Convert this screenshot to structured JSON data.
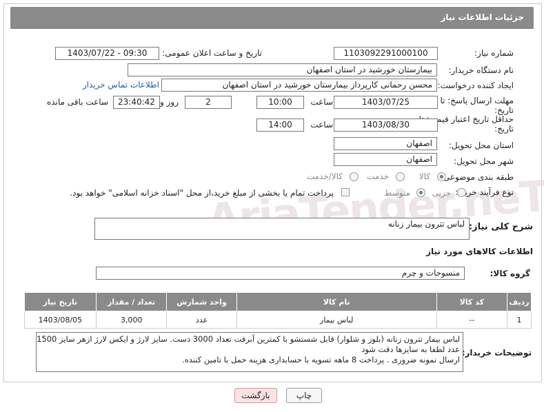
{
  "header": {
    "title": "جزئیات اطلاعات نیاز"
  },
  "fields": {
    "need_number_label": "شماره نیاز:",
    "need_number": "1103092291000100",
    "announce_label": "تاریخ و ساعت اعلان عمومی:",
    "announce_value": "1403/07/22 - 09:30",
    "buyer_org_label": "نام دستگاه خریدار:",
    "buyer_org": "بیمارستان خورشید در استان اصفهان",
    "requester_label": "ایجاد کننده درخواست:",
    "requester": "محسن رحمانی کارپرداز بیمارستان خورشید در استان اصفهان",
    "buyer_contact_link": "اطلاعات تماس خریدار",
    "reply_deadline_label": "مهلت ارسال پاسخ: تا",
    "reply_deadline_label2": "تاریخ:",
    "reply_date": "1403/07/25",
    "time_label": "ساعت",
    "reply_time": "10:00",
    "days_value": "2",
    "days_label": "روز و",
    "remaining_time": "23:40:42",
    "remaining_label": "ساعت باقی مانده",
    "price_validity_label": "حداقل تاریخ اعتبار قیمت: تا",
    "price_validity_label2": "تاریخ:",
    "price_validity_date": "1403/08/30",
    "price_validity_time": "14:00",
    "province_label": "استان محل تحویل:",
    "province": "اصفهان",
    "city_label": "شهر محل تحویل:",
    "city": "اصفهان",
    "category_label": "طبقه بندی موضوعی:",
    "category_options": [
      "کالا",
      "خدمت",
      "کالا/خدمت"
    ],
    "category_selected": "کالا",
    "process_label": "نوع فرآیند خرید :",
    "process_options": [
      "جزیی",
      "متوسط"
    ],
    "process_selected": "متوسط",
    "payment_note": "پرداخت تمام یا بخشی از مبلغ خرید،از محل \"اسناد خزانه اسلامی\" خواهد بود."
  },
  "summary": {
    "label": "شرح کلی نیاز:",
    "text": "لباس تترون بیمار زنانه"
  },
  "goods": {
    "section_title": "اطلاعات کالاهای مورد نیاز",
    "group_label": "گروه کالا:",
    "group_value": "منسوجات و چرم",
    "columns": [
      "ردیف",
      "کد کالا",
      "نام کالا",
      "واحد شمارش",
      "تعداد / مقدار",
      "تاریخ نیاز"
    ],
    "rows": [
      {
        "index": "1",
        "code": "--",
        "name": "لباس بیمار",
        "unit": "عدد",
        "qty": "3,000",
        "date": "1403/08/05"
      }
    ]
  },
  "buyer_notes": {
    "label": "توضیحات خریدار:",
    "line1": "لباس بیمار تترون زنانه (بلوز و شلوار) قابل شستشو با کمترین آبرفت تعداد 3000 دست. سایز لارژ و ایکس لارژ ازهر سایز 1500",
    "line2": "عدد لطفا به سایزها دقت شود",
    "line3": "ارسال نمونه ضروری . پرداخت 8 ماهه تسویه با حسابداری  هزینه حمل با تامین کننده."
  },
  "buttons": {
    "print": "چاپ",
    "back": "بازگشت"
  },
  "watermark": "AriaTender.neT",
  "colors": {
    "titlebar": "#8a8a8a",
    "link": "#1a5fb4",
    "back_button_bg": "#fbe3e3",
    "print_button_bg": "#f6f6f6"
  }
}
